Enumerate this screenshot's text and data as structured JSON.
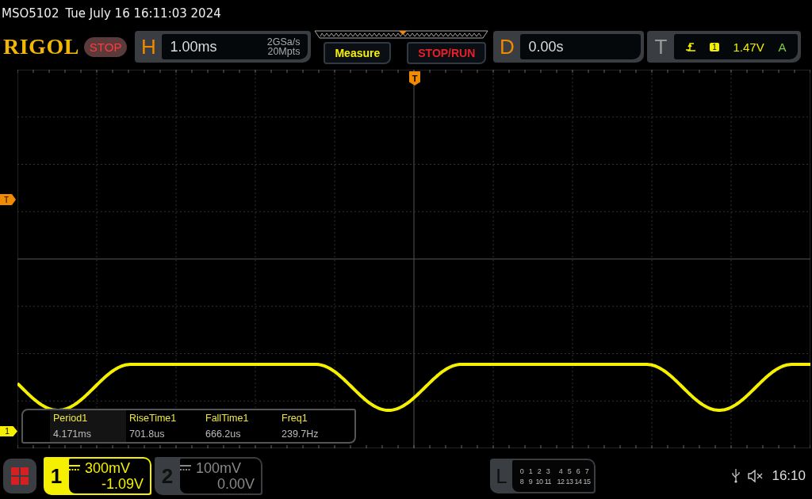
{
  "status_line": {
    "model": "MSO5102",
    "datetime": "Tue July 16 16:11:03 2024"
  },
  "logo": "RIGOL",
  "run_state": "STOP",
  "horizontal": {
    "label": "H",
    "timebase": "1.00ms",
    "sample_rate": "2GSa/s",
    "memory_depth": "20Mpts"
  },
  "buttons": [
    {
      "label": "Measure",
      "kind": "measure"
    },
    {
      "label": "STOP/RUN",
      "kind": "stoprun"
    }
  ],
  "delay": {
    "label": "D",
    "value": "0.00s"
  },
  "trigger": {
    "label": "T",
    "source": "1",
    "level": "1.47V",
    "mode": "A"
  },
  "markers": {
    "trigger_position": "T",
    "trigger_level": "T",
    "channel_1": "1"
  },
  "measurements": [
    {
      "name": "Period1",
      "value": "4.171ms",
      "selected": true
    },
    {
      "name": "RiseTime1",
      "value": "701.8us",
      "selected": false
    },
    {
      "name": "FallTime1",
      "value": "666.2us",
      "selected": false
    },
    {
      "name": "Freq1",
      "value": "239.7Hz",
      "selected": false
    }
  ],
  "channels": [
    {
      "number": "1",
      "scale": "300mV",
      "offset": "-1.09V",
      "active": true
    },
    {
      "number": "2",
      "scale": "100mV",
      "offset": "0.00V",
      "active": false
    }
  ],
  "logic": {
    "label": "L",
    "rows": [
      [
        "0",
        "1",
        "2",
        "3",
        "4",
        "5",
        "6",
        "7"
      ],
      [
        "8",
        "9",
        "10",
        "11",
        "12",
        "13",
        "14",
        "15"
      ]
    ]
  },
  "clock": "16:10"
}
